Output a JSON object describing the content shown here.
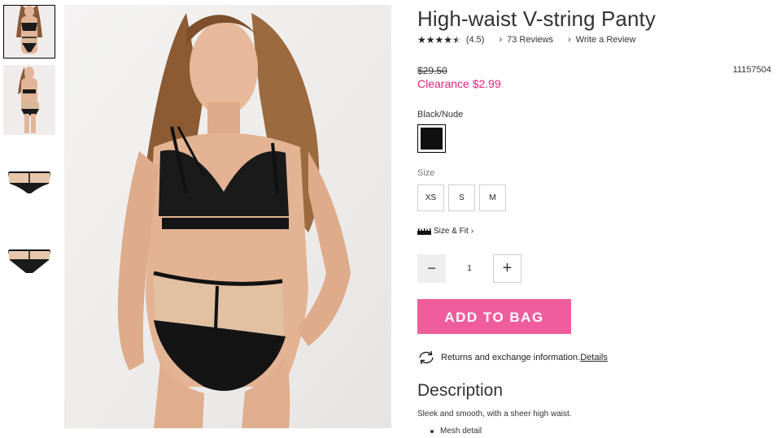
{
  "product": {
    "title": "High-waist V-string Panty",
    "rating_value": "(4.5)",
    "stars_filled": 4.5,
    "reviews_label": "73 Reviews",
    "write_review_label": "Write a Review",
    "original_price": "$29.50",
    "clearance_price": "Clearance $2.99",
    "sku": "11157504",
    "color_label": "Black/Nude",
    "color_swatch": "#111111",
    "size_label": "Size",
    "sizes": [
      "XS",
      "S",
      "M"
    ],
    "size_fit_label": "Size & Fit",
    "quantity": "1",
    "add_to_bag_label": "ADD TO BAG",
    "returns_text": "Returns and exchange information.",
    "returns_link": "Details",
    "description_title": "Description",
    "description_text": "Sleek and smooth, with a sheer high waist.",
    "description_bullets": [
      "Mesh detail"
    ]
  },
  "gallery": {
    "thumbnail_count": 4,
    "active_index": 0
  },
  "colors": {
    "accent_pink": "#ef5d9c",
    "clearance_pink": "#e0217f"
  },
  "icons": {
    "star": "star-icon",
    "chevron": "chevron-right-icon",
    "ruler": "ruler-icon",
    "minus": "minus-icon",
    "plus": "plus-icon",
    "returns": "returns-exchange-icon"
  }
}
